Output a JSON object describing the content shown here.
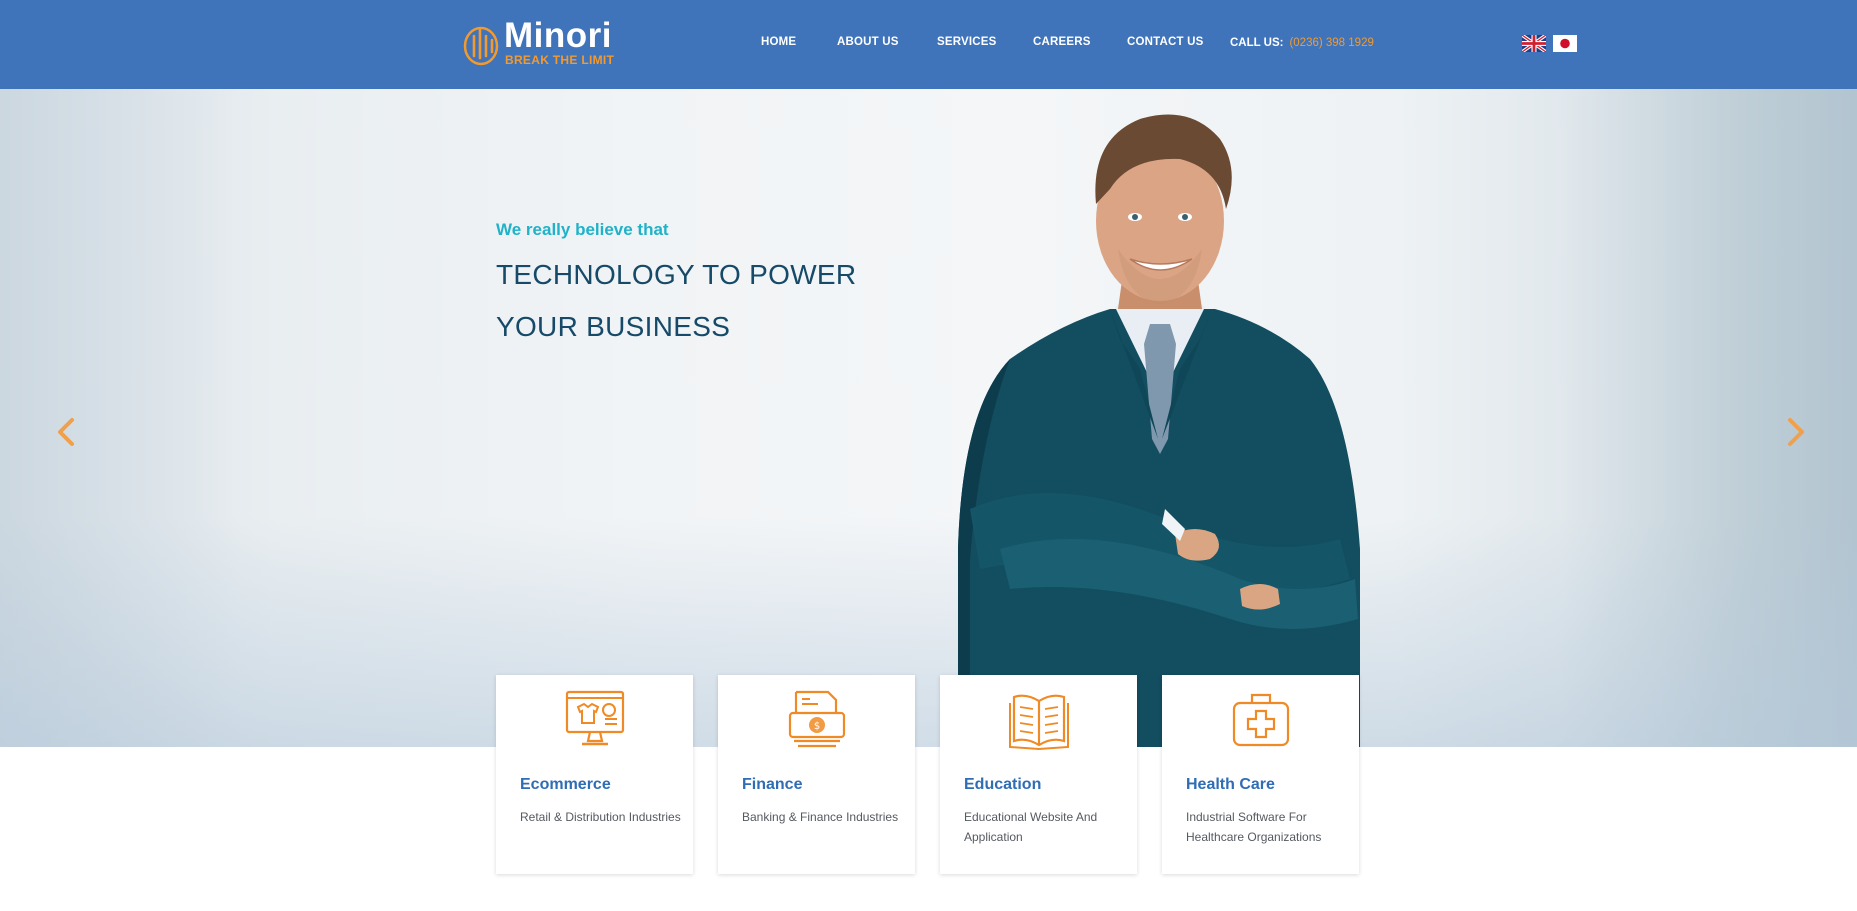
{
  "brand": {
    "name": "Minori",
    "tagline": "BREAK THE LIMIT"
  },
  "nav": {
    "items": [
      {
        "label": "HOME"
      },
      {
        "label": "ABOUT US"
      },
      {
        "label": "SERVICES"
      },
      {
        "label": "CAREERS"
      },
      {
        "label": "CONTACT US"
      }
    ],
    "call_label": "CALL US:",
    "call_number": "(0236) 398 1929",
    "languages": [
      "uk-flag-icon",
      "japan-flag-icon"
    ]
  },
  "hero": {
    "kicker": "We really believe that",
    "headline_line1": "TECHNOLOGY TO POWER",
    "headline_line2": "YOUR BUSINESS",
    "prev_icon": "chevron-left-icon",
    "next_icon": "chevron-right-icon"
  },
  "cards": [
    {
      "title": "Ecommerce",
      "desc": "Retail & Distribution Industries",
      "icon": "ecommerce-monitor-icon"
    },
    {
      "title": "Finance",
      "desc": "Banking & Finance Industries",
      "icon": "finance-money-icon"
    },
    {
      "title": "Education",
      "desc": "Educational Website And Application",
      "icon": "open-book-icon"
    },
    {
      "title": "Health Care",
      "desc": "Industrial Software For Healthcare Organizations",
      "icon": "medical-kit-icon"
    }
  ],
  "colors": {
    "header": "#3f73ba",
    "accent": "#f39a2e",
    "kicker": "#1fb2c9",
    "headline": "#164a68",
    "card_title": "#2f6db5"
  }
}
